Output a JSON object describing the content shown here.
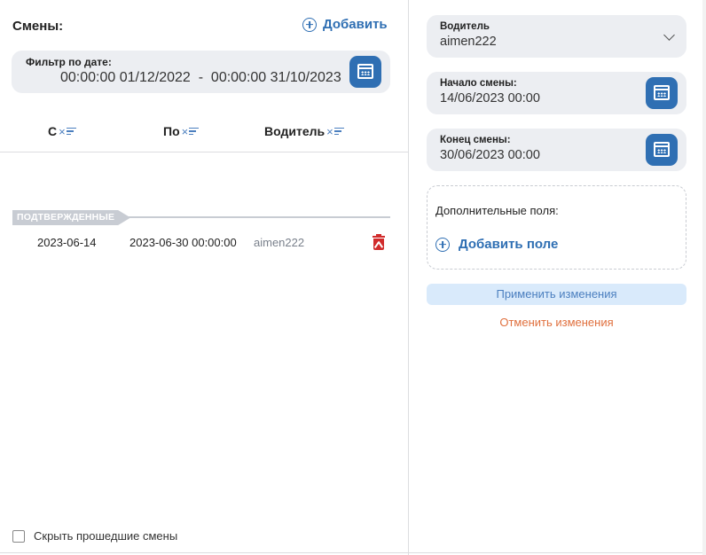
{
  "shifts": {
    "title": "Смены:",
    "add_label": "Добавить",
    "filter": {
      "label": "Фильтр по дате:",
      "range": "00:00:00 01/12/2022  -  00:00:00 31/10/2023"
    },
    "columns": [
      {
        "label": "С",
        "sort_icon": "clear-sort-icon"
      },
      {
        "label": "По",
        "sort_icon": "clear-sort-icon"
      },
      {
        "label": "Водитель",
        "sort_icon": "clear-sort-icon"
      }
    ],
    "group": {
      "label": "ПОДТВЕРЖДЕННЫЕ",
      "rows": [
        {
          "from": "2023-06-14",
          "to": "2023-06-30 00:00:00",
          "driver": "aimen222"
        }
      ]
    },
    "hide_past_label": "Скрыть прошедшие смены",
    "hide_past_checked": false
  },
  "editor": {
    "driver": {
      "label": "Водитель",
      "value": "aimen222"
    },
    "start": {
      "label": "Начало смены:",
      "value": "14/06/2023 00:00"
    },
    "end": {
      "label": "Конец смены:",
      "value": "30/06/2023 00:00"
    },
    "extra_fields_label": "Дополнительные поля:",
    "add_field_label": "Добавить поле",
    "apply_label": "Применить изменения",
    "cancel_label": "Отменить изменения"
  },
  "colors": {
    "accent": "#2f6fb3",
    "danger": "#d12b2b",
    "cancel": "#e0703e",
    "field_bg": "#eceef2"
  }
}
